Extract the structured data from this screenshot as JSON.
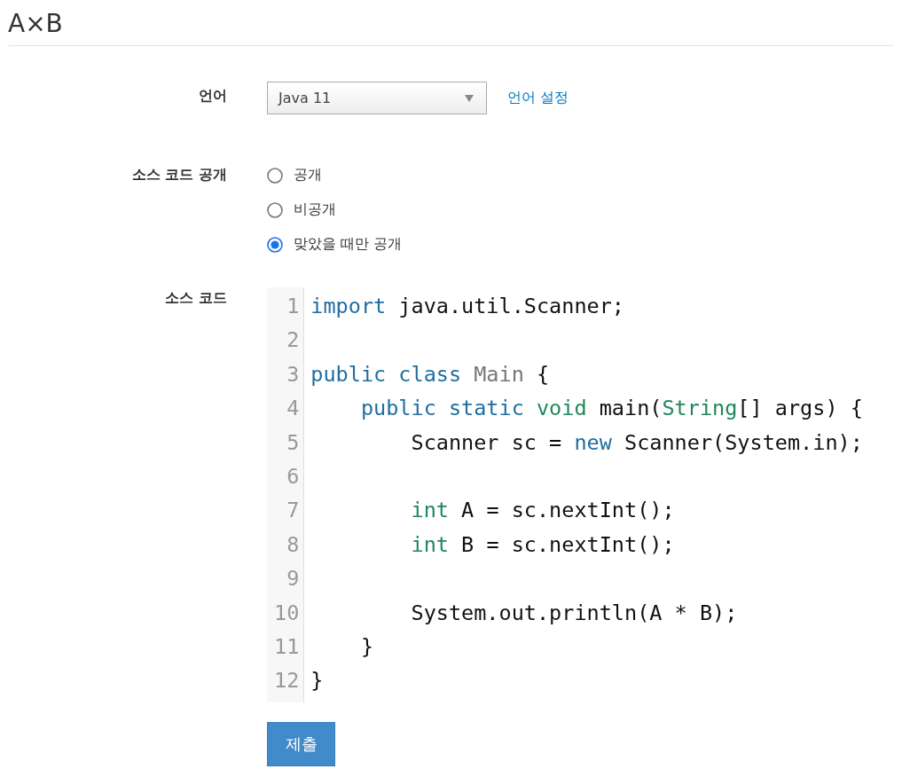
{
  "title": "A×B",
  "language": {
    "label": "언어",
    "value": "Java 11",
    "settings_link": "언어 설정"
  },
  "visibility": {
    "label": "소스 코드 공개",
    "options": [
      {
        "label": "공개",
        "selected": false
      },
      {
        "label": "비공개",
        "selected": false
      },
      {
        "label": "맞았을 때만 공개",
        "selected": true
      }
    ]
  },
  "source": {
    "label": "소스 코드",
    "lines": [
      {
        "number": "1",
        "tokens": [
          {
            "kind": "keyword",
            "text": "import"
          },
          {
            "kind": "plain",
            "text": " java.util.Scanner;"
          }
        ]
      },
      {
        "number": "2"
      },
      {
        "number": "3",
        "tokens": [
          {
            "kind": "keyword",
            "text": "public class"
          },
          {
            "kind": "def",
            "text": " Main"
          },
          {
            "kind": "plain",
            "text": " {"
          }
        ]
      },
      {
        "number": "4",
        "tokens": [
          {
            "kind": "keyword",
            "text": "    public static"
          },
          {
            "kind": "type",
            "text": " void"
          },
          {
            "kind": "plain",
            "text": " main("
          },
          {
            "kind": "type",
            "text": "String"
          },
          {
            "kind": "plain",
            "text": "[] args) {"
          }
        ]
      },
      {
        "number": "5",
        "tokens": [
          {
            "kind": "plain",
            "text": "        Scanner sc = "
          },
          {
            "kind": "keyword",
            "text": "new"
          },
          {
            "kind": "plain",
            "text": " Scanner(System.in);"
          }
        ]
      },
      {
        "number": "6"
      },
      {
        "number": "7",
        "tokens": [
          {
            "kind": "type",
            "text": "        int"
          },
          {
            "kind": "plain",
            "text": " A = sc.nextInt();"
          }
        ]
      },
      {
        "number": "8",
        "tokens": [
          {
            "kind": "type",
            "text": "        int"
          },
          {
            "kind": "plain",
            "text": " B = sc.nextInt();"
          }
        ]
      },
      {
        "number": "9"
      },
      {
        "number": "10",
        "tokens": [
          {
            "kind": "plain",
            "text": "        System.out.println(A * B);"
          }
        ]
      },
      {
        "number": "11",
        "tokens": [
          {
            "kind": "plain",
            "text": "    }"
          }
        ]
      },
      {
        "number": "12",
        "tokens": [
          {
            "kind": "plain",
            "text": "}"
          }
        ]
      }
    ]
  },
  "submit": "제출"
}
